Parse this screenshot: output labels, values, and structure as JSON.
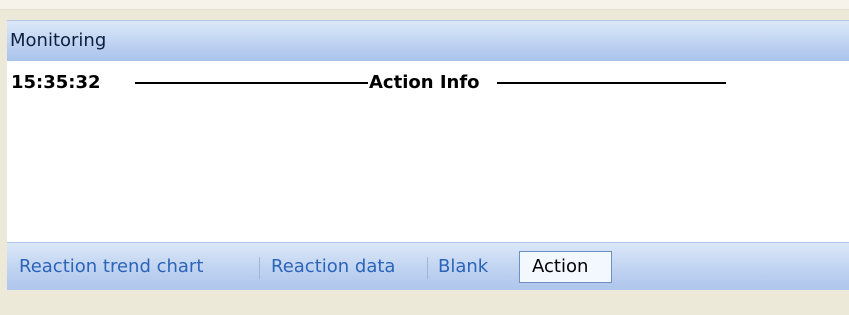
{
  "panel": {
    "title": "Monitoring"
  },
  "log": {
    "time": "15:35:32",
    "heading": "Action Info"
  },
  "tabs": [
    {
      "label": "Reaction trend chart",
      "active": false
    },
    {
      "label": "Reaction data",
      "active": false
    },
    {
      "label": "Blank",
      "active": false
    },
    {
      "label": "Action",
      "active": true
    }
  ],
  "colors": {
    "header_gradient_top": "#dce8f8",
    "header_gradient_bottom": "#a9c3ec",
    "tab_text": "#2b64b9",
    "window_background": "#ece9d8"
  }
}
